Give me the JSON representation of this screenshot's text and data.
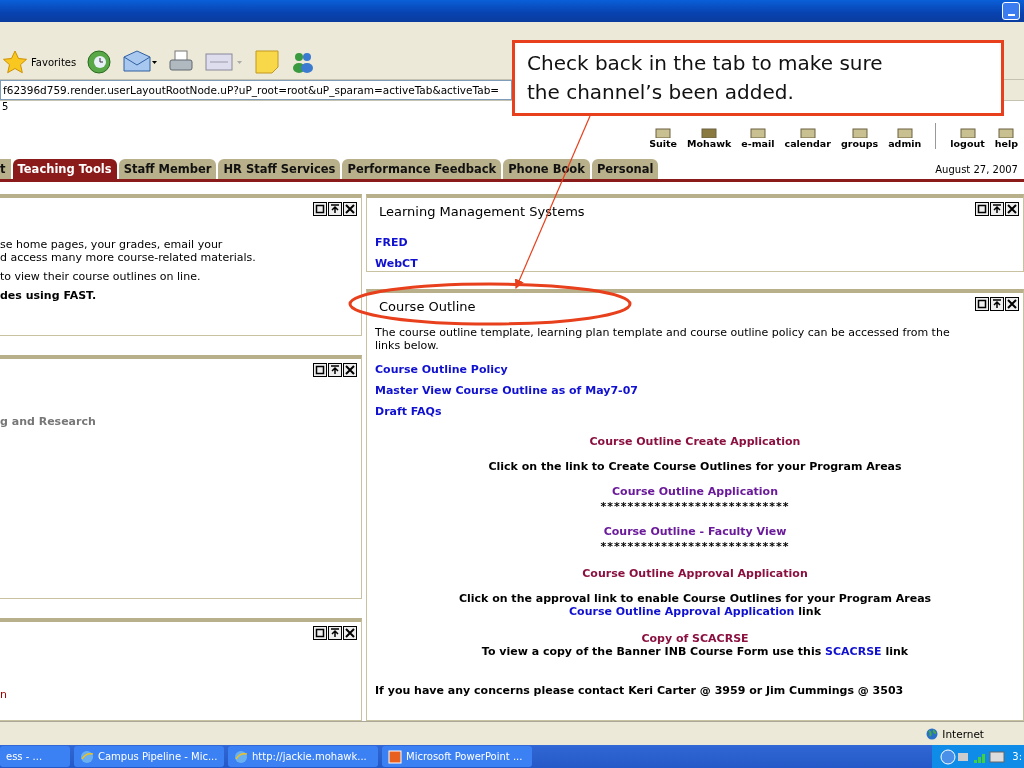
{
  "browser": {
    "toolbar": {
      "favorites": "Favorites"
    },
    "address": "f62396d759.render.userLayoutRootNode.uP?uP_root=root&uP_sparam=activeTab&activeTab=",
    "links_bar": "5"
  },
  "portal": {
    "nav": [
      "Suite",
      "Mohawk",
      "e-mail",
      "calendar",
      "groups",
      "admin",
      "logout",
      "help"
    ],
    "tabs": [
      {
        "label": "t",
        "selected": false
      },
      {
        "label": "Teaching Tools",
        "selected": true
      },
      {
        "label": "Staff Member",
        "selected": false
      },
      {
        "label": "HR Staff Services",
        "selected": false
      },
      {
        "label": "Performance Feedback",
        "selected": false
      },
      {
        "label": "Phone Book",
        "selected": false
      },
      {
        "label": "Personal",
        "selected": false
      }
    ],
    "date": "August 27, 2007"
  },
  "left_panels": [
    {
      "lines": [
        {
          "kind": "text",
          "text": "se home pages, your grades, email your\nd access many more course-related materials."
        },
        {
          "kind": "text",
          "text": "to view their course outlines on line."
        },
        {
          "kind": "bold",
          "text": "des using FAST."
        }
      ]
    },
    {
      "lines": [
        {
          "kind": "muted",
          "text": "g and Research"
        }
      ]
    },
    {
      "lines": [
        {
          "kind": "red",
          "text": "n"
        }
      ]
    }
  ],
  "right_panels": [
    {
      "title": "Learning Management Systems",
      "lines": [
        {
          "kind": "link",
          "text": "FRED"
        },
        {
          "kind": "link",
          "text": "WebCT"
        }
      ]
    },
    {
      "title": "Course Outline",
      "lines": [
        {
          "kind": "text",
          "text": "The course outline template, learning plan template and course outline policy can be accessed from the links below."
        },
        {
          "kind": "link",
          "text": "Course Outline Policy"
        },
        {
          "kind": "link",
          "text": "Master View Course Outline as of May7-07"
        },
        {
          "kind": "link",
          "text": "Draft FAQs"
        },
        {
          "kind": "maroon",
          "text": "Course Outline Create Application"
        },
        {
          "kind": "center",
          "parts": [
            {
              "text": "Click on the link to Create Course Outlines for your Program Areas"
            }
          ]
        },
        {
          "kind": "purple",
          "text": "Course Outline Application"
        },
        {
          "kind": "stars",
          "text": "****************************"
        },
        {
          "kind": "purple",
          "text": "Course Outline - Faculty View"
        },
        {
          "kind": "stars",
          "text": "****************************"
        },
        {
          "kind": "maroon",
          "text": "Course Outline Approval Application"
        },
        {
          "kind": "center",
          "parts": [
            {
              "text": "Click on the approval link to enable Course Outlines for your Program Areas"
            }
          ]
        },
        {
          "kind": "center",
          "parts": [
            {
              "text": "Course Outline Approval Application",
              "link": true
            },
            {
              "text": "link"
            }
          ]
        },
        {
          "kind": "maroon",
          "text": "Copy of SCACRSE"
        },
        {
          "kind": "center",
          "parts": [
            {
              "text": "To view a copy of the Banner INB Course Form use this"
            },
            {
              "text": "SCACRSE",
              "link": true
            },
            {
              "text": "link"
            }
          ]
        },
        {
          "kind": "contact",
          "text": "If you have any concerns please contact Keri Carter @ 3959 or Jim Cummings @ 3503"
        }
      ]
    }
  ],
  "status_bar": {
    "zone": "Internet"
  },
  "taskbar": {
    "buttons": [
      "ess - ...",
      "Campus Pipeline - Mic...",
      "http://jackie.mohawk...",
      "Microsoft PowerPoint ..."
    ],
    "clock": "3:"
  },
  "callout": {
    "text": "Check back in the tab to make sure\nthe channel’s been added."
  }
}
